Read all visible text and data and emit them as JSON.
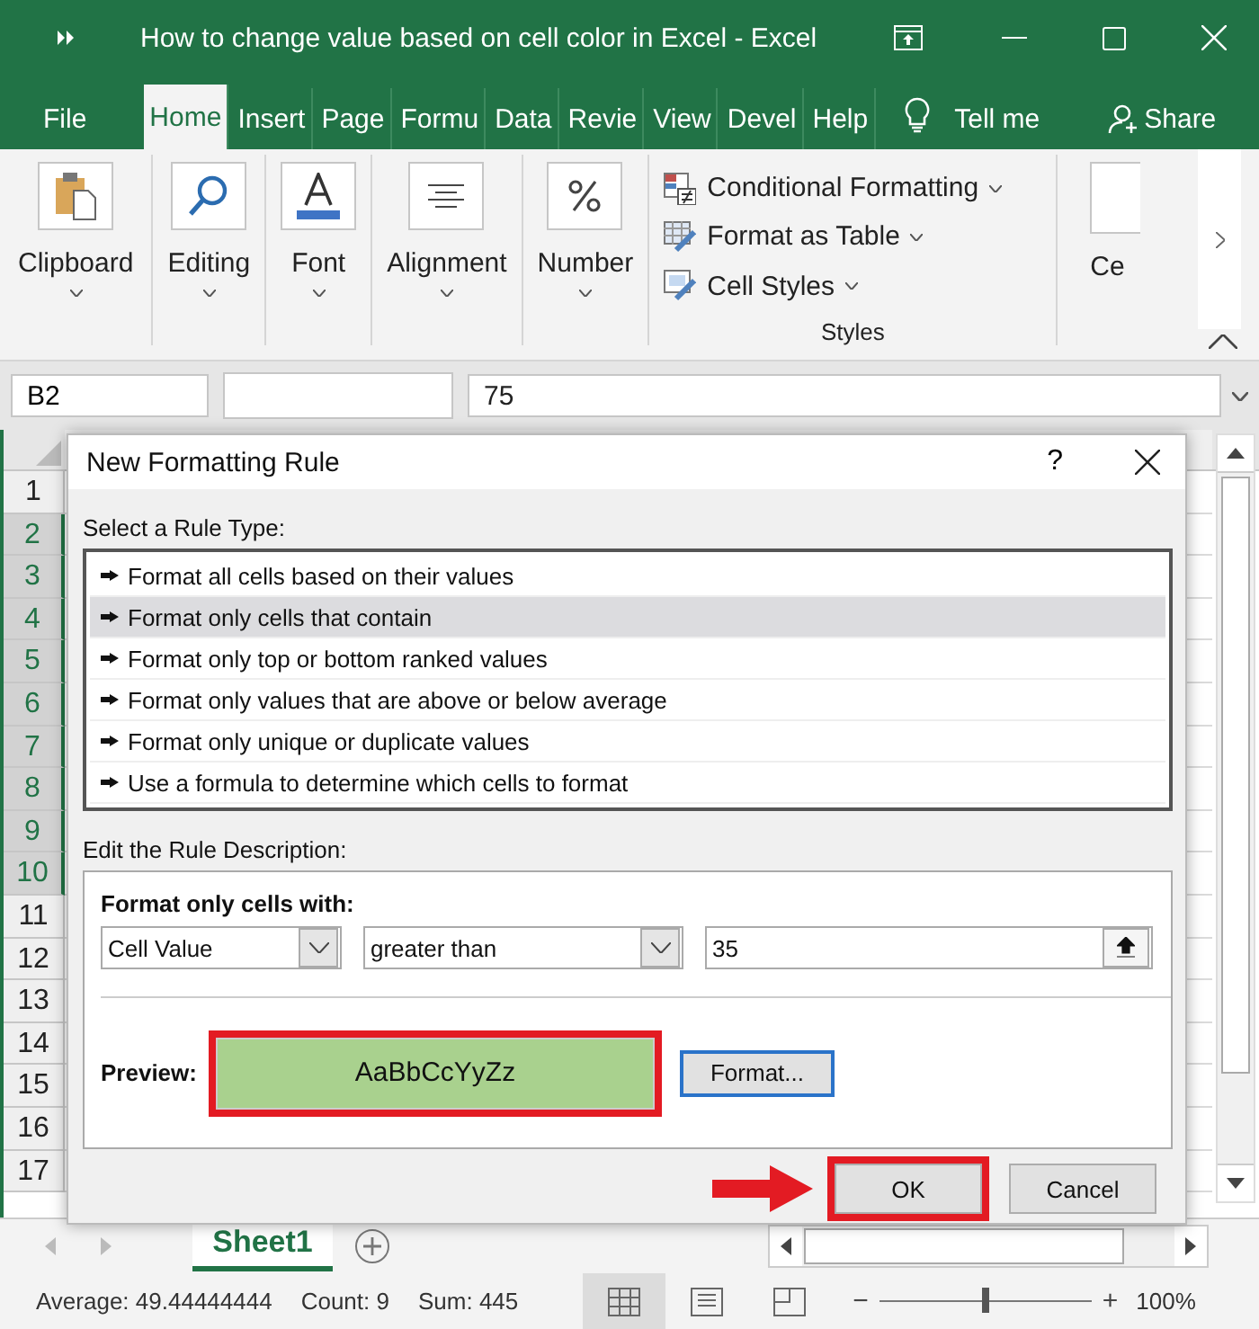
{
  "window": {
    "title": "How to change value based on cell color in Excel  -  Excel"
  },
  "tabs": [
    {
      "label": "File",
      "selected": false
    },
    {
      "label": "Home",
      "selected": true
    },
    {
      "label": "Insert",
      "selected": false
    },
    {
      "label": "Page",
      "selected": false
    },
    {
      "label": "Formu",
      "selected": false
    },
    {
      "label": "Data",
      "selected": false
    },
    {
      "label": "Revie",
      "selected": false
    },
    {
      "label": "View",
      "selected": false
    },
    {
      "label": "Devel",
      "selected": false
    },
    {
      "label": "Help",
      "selected": false
    }
  ],
  "tell_me": "Tell me",
  "share": "Share",
  "ribbon": {
    "groups": [
      {
        "label": "Clipboard",
        "kind": "clipboard"
      },
      {
        "label": "Editing",
        "kind": "editing"
      },
      {
        "label": "Font",
        "kind": "font"
      },
      {
        "label": "Alignment",
        "kind": "alignment"
      },
      {
        "label": "Number",
        "kind": "number"
      }
    ],
    "styles": {
      "items": [
        {
          "label": "Conditional Formatting",
          "kind": "conditional"
        },
        {
          "label": "Format as Table",
          "kind": "table"
        },
        {
          "label": "Cell Styles",
          "kind": "cellstyles"
        }
      ],
      "label": "Styles"
    },
    "cut_group": "Ce"
  },
  "name_box": "B2",
  "formula": "75",
  "row_headers": [
    {
      "label": "1",
      "selected": false
    },
    {
      "label": "2",
      "selected": true
    },
    {
      "label": "3",
      "selected": true
    },
    {
      "label": "4",
      "selected": true
    },
    {
      "label": "5",
      "selected": true
    },
    {
      "label": "6",
      "selected": true
    },
    {
      "label": "7",
      "selected": true
    },
    {
      "label": "8",
      "selected": true
    },
    {
      "label": "9",
      "selected": true
    },
    {
      "label": "10",
      "selected": true
    },
    {
      "label": "11",
      "selected": false
    },
    {
      "label": "12",
      "selected": false
    },
    {
      "label": "13",
      "selected": false
    },
    {
      "label": "14",
      "selected": false
    },
    {
      "label": "15",
      "selected": false
    },
    {
      "label": "16",
      "selected": false
    },
    {
      "label": "17",
      "selected": false
    }
  ],
  "dialog": {
    "title": "New Formatting Rule",
    "help": "?",
    "rule_type_label": "Select a Rule Type:",
    "rule_types": [
      {
        "label": "Format all cells based on their values",
        "selected": false
      },
      {
        "label": "Format only cells that contain",
        "selected": true
      },
      {
        "label": "Format only top or bottom ranked values",
        "selected": false
      },
      {
        "label": "Format only values that are above or below average",
        "selected": false
      },
      {
        "label": "Format only unique or duplicate values",
        "selected": false
      },
      {
        "label": "Use a formula to determine which cells to format",
        "selected": false
      }
    ],
    "description_label": "Edit the Rule Description:",
    "condition_heading": "Format only cells with:",
    "condition_type": "Cell Value",
    "operator": "greater than",
    "value": "35",
    "preview_label": "Preview:",
    "preview_text": "AaBbCcYyZz",
    "preview_annotated": true,
    "format_button": "Format...",
    "buttons": [
      {
        "label": "OK",
        "annotated": true
      },
      {
        "label": "Cancel",
        "annotated": false
      }
    ]
  },
  "sheet_tabs": [
    {
      "label": "Sheet1",
      "selected": true
    }
  ],
  "status": {
    "average": "Average: 49.44444444",
    "count": "Count: 9",
    "sum": "Sum: 445",
    "zoom": "100%",
    "zoom_out": "−",
    "zoom_in": "+",
    "zoom_slider": {
      "level": 0.5
    }
  }
}
